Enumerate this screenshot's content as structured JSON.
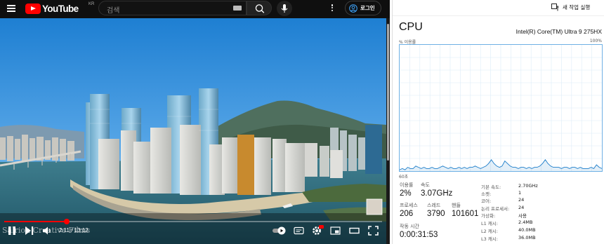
{
  "youtube": {
    "logo_text": "YouTube",
    "region": "KR",
    "search_placeholder": "검색",
    "login_label": "로그인",
    "watermark": "Salrioh Creative Films",
    "time": "2:11 / 13:12",
    "progress_fraction": 0.166,
    "icons": [
      "menu-icon",
      "search-icon",
      "mic-icon",
      "more-icon",
      "user-icon",
      "play-icon",
      "pause-icon",
      "next-icon",
      "volume-icon",
      "autoplay-toggle-icon",
      "subtitles-icon",
      "settings-icon",
      "miniplayer-icon",
      "theater-icon",
      "fullscreen-icon"
    ],
    "colors": {
      "brand": "#ff0000",
      "background": "#0f0f0f"
    }
  },
  "taskmanager": {
    "run_task": "새 작업 실행",
    "title": "CPU",
    "cpu_name": "Intel(R) Core(TM) Ultra 9 275HX",
    "graph_top_left": "% 이용률",
    "graph_top_right": "100%",
    "graph_bottom_left": "60초",
    "graph_color": "#1a7cc9",
    "utilization_series": [
      1,
      2,
      1,
      3,
      2,
      2,
      4,
      3,
      2,
      3,
      2,
      2,
      3,
      2,
      2,
      3,
      4,
      3,
      2,
      3,
      2,
      2,
      3,
      2,
      3,
      2,
      3,
      3,
      4,
      3,
      2,
      3,
      4,
      6,
      9,
      6,
      4,
      3,
      4,
      8,
      6,
      4,
      3,
      3,
      2,
      3,
      3,
      2,
      3,
      2,
      3,
      3,
      4,
      6,
      9,
      6,
      4,
      3,
      3,
      3,
      2,
      3,
      3,
      2,
      3,
      3,
      2,
      3,
      2,
      2,
      2,
      3,
      2,
      5,
      3,
      2
    ],
    "stats": {
      "utilization_label": "이용률",
      "utilization_value": "2%",
      "speed_label": "속도",
      "speed_value": "3.07GHz",
      "processes_label": "프로세스",
      "processes_value": "206",
      "threads_label": "스레드",
      "threads_value": "3790",
      "handles_label": "핸들",
      "handles_value": "101601",
      "uptime_label": "작동 시간",
      "uptime_value": "0:00:31:53"
    },
    "specs": [
      {
        "label": "기본 속도:",
        "value": "2.70GHz"
      },
      {
        "label": "소켓:",
        "value": "1"
      },
      {
        "label": "코어:",
        "value": "24"
      },
      {
        "label": "논리 프로세서:",
        "value": "24"
      },
      {
        "label": "가상화:",
        "value": "사용"
      },
      {
        "label": "L1 캐시:",
        "value": "2.4MB"
      },
      {
        "label": "L2 캐시:",
        "value": "40.0MB"
      },
      {
        "label": "L3 캐시:",
        "value": "36.0MB"
      }
    ]
  }
}
